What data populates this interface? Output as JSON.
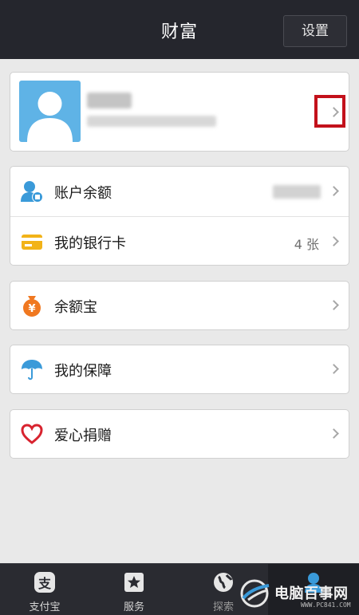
{
  "header": {
    "title": "财富",
    "settings_label": "设置"
  },
  "profile": {},
  "account": {
    "balance_label": "账户余额",
    "bank_card_label": "我的银行卡",
    "bank_card_count": "4 张"
  },
  "services": {
    "yuebao_label": "余额宝",
    "baozhang_label": "我的保障",
    "aixin_label": "爱心捐赠"
  },
  "tabbar": {
    "tab1_label": "支付宝",
    "tab2_label": "服务",
    "tab3_label": "探索",
    "active_tab": 4
  },
  "watermark": {
    "text": "电脑百事网",
    "url": "WWW.PC841.COM"
  },
  "colors": {
    "header_bg": "#25262d",
    "page_bg": "#e9e9e9",
    "highlight_red": "#c3111b",
    "avatar_blue": "#5fb3e6",
    "balance_icon_blue": "#3a9ad9",
    "card_icon_yellow": "#f2b318",
    "yuebao_orange": "#f07820",
    "baozhang_blue": "#3a9ad9",
    "aixin_red": "#d8232f"
  }
}
